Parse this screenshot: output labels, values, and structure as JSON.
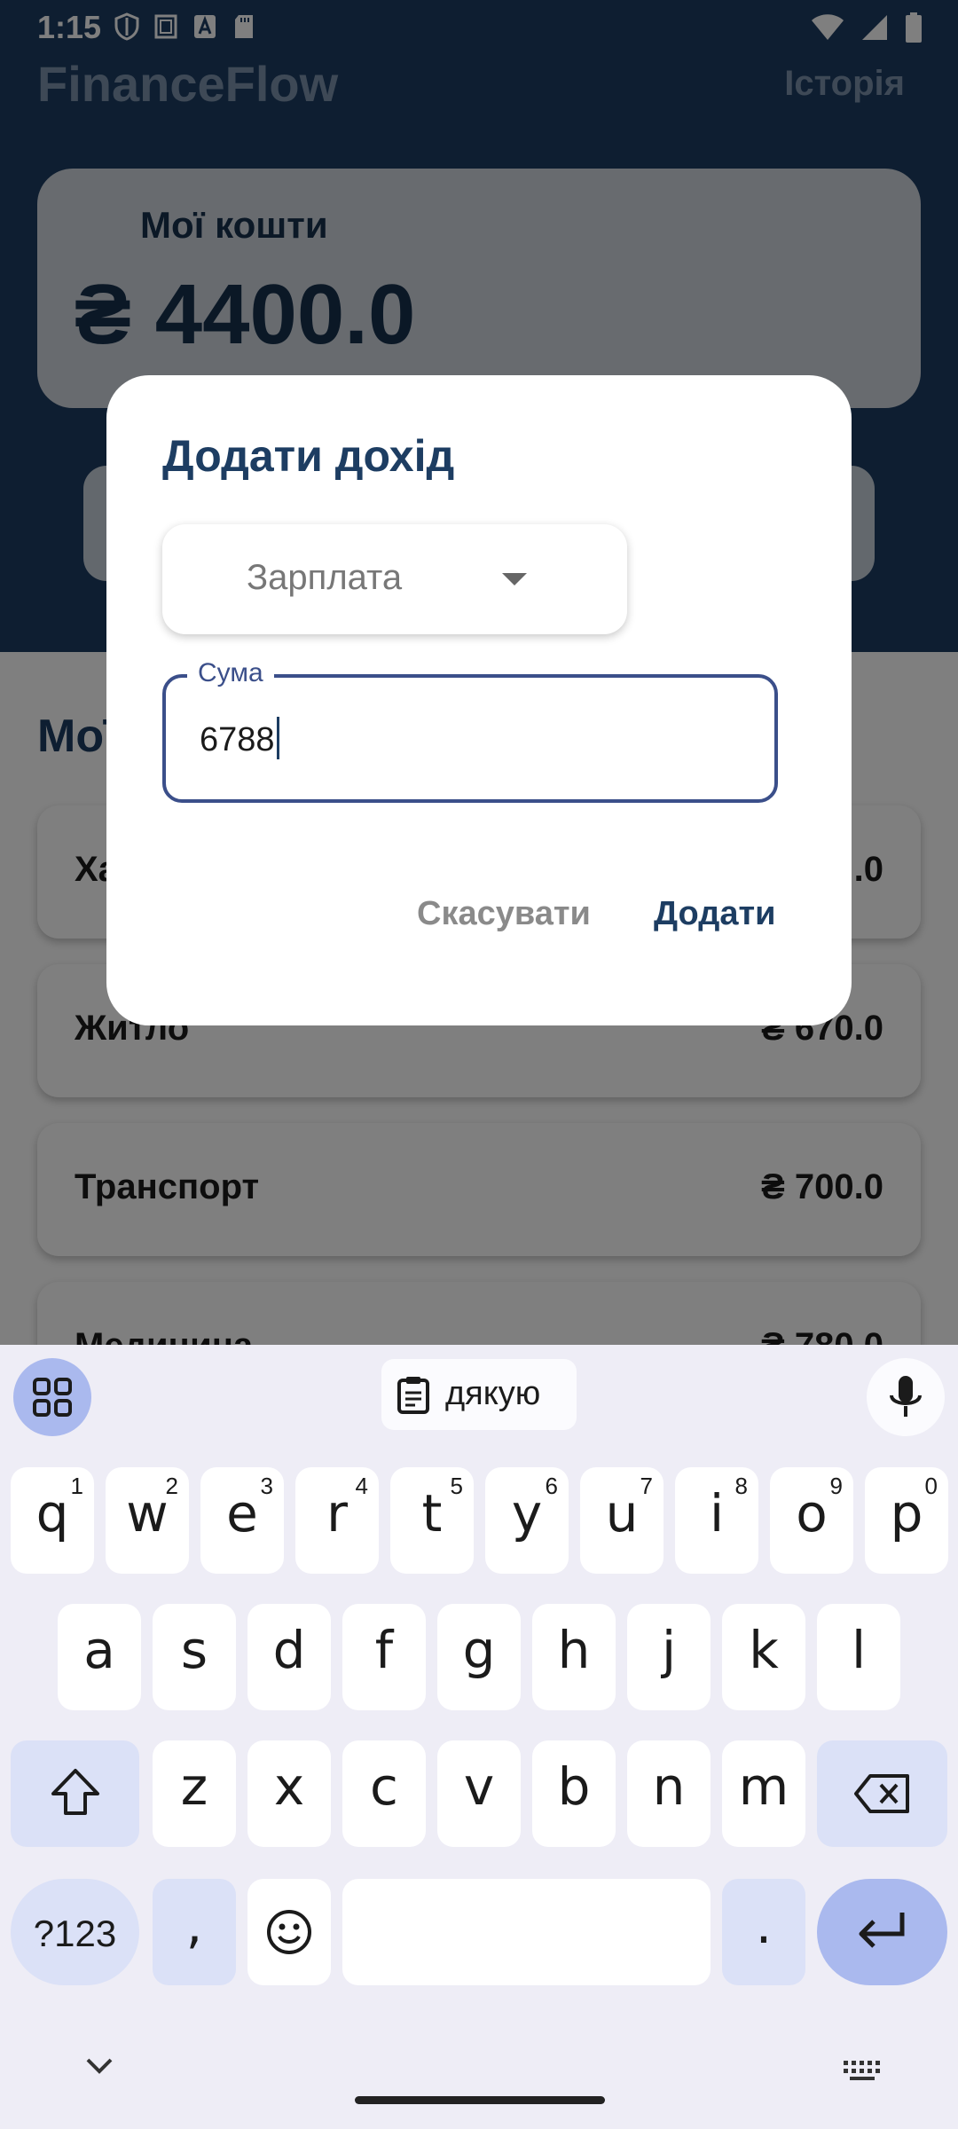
{
  "status_bar": {
    "time": "1:15"
  },
  "app": {
    "title": "FinanceFlow",
    "history_link": "Історія",
    "balance": {
      "label": "Мої кошти",
      "value": "₴ 4400.0"
    },
    "section_title": "Мої",
    "expenses": [
      {
        "name": "Ха",
        "amount": ".0"
      },
      {
        "name": "Житло",
        "amount": "₴ 670.0"
      },
      {
        "name": "Транспорт",
        "amount": "₴ 700.0"
      },
      {
        "name": "Медицина",
        "amount": "₴ 780.0"
      }
    ]
  },
  "dialog": {
    "title": "Додати дохід",
    "category_selected": "Зарплата",
    "amount_label": "Сума",
    "amount_value": "6788",
    "cancel_label": "Скасувати",
    "confirm_label": "Додати"
  },
  "keyboard": {
    "suggestion": "дякую",
    "row1": [
      {
        "c": "q",
        "n": "1"
      },
      {
        "c": "w",
        "n": "2"
      },
      {
        "c": "e",
        "n": "3"
      },
      {
        "c": "r",
        "n": "4"
      },
      {
        "c": "t",
        "n": "5"
      },
      {
        "c": "y",
        "n": "6"
      },
      {
        "c": "u",
        "n": "7"
      },
      {
        "c": "i",
        "n": "8"
      },
      {
        "c": "o",
        "n": "9"
      },
      {
        "c": "p",
        "n": "0"
      }
    ],
    "row2": [
      "a",
      "s",
      "d",
      "f",
      "g",
      "h",
      "j",
      "k",
      "l"
    ],
    "row3": [
      "z",
      "x",
      "c",
      "v",
      "b",
      "n",
      "m"
    ],
    "symbols_label": "?123",
    "comma_label": ",",
    "period_label": "."
  }
}
